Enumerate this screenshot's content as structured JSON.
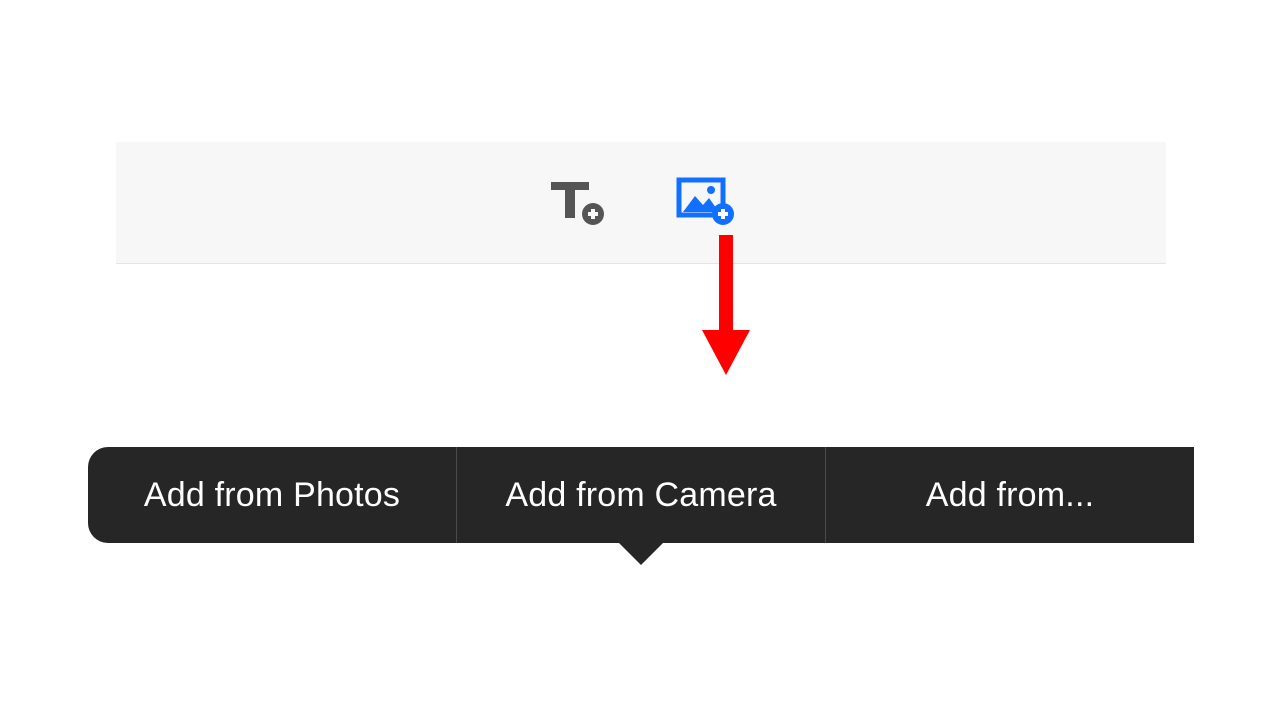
{
  "toolbar": {
    "add_text_icon": "add-text-icon",
    "add_image_icon": "add-image-icon"
  },
  "annotation": {
    "arrow_color": "#ff0000"
  },
  "popover": {
    "items": [
      {
        "label": "Add from Photos"
      },
      {
        "label": "Add from Camera"
      },
      {
        "label": "Add from..."
      }
    ]
  }
}
